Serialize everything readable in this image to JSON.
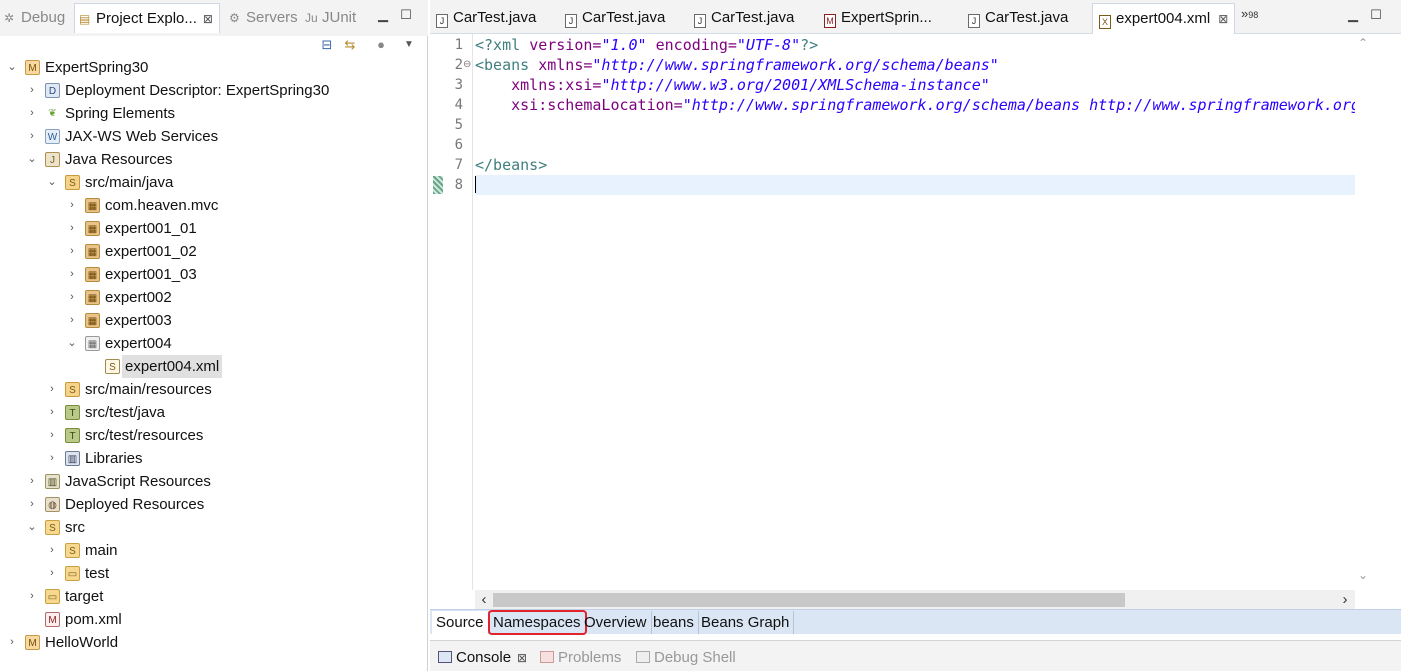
{
  "left_view": {
    "tabs": [
      {
        "label": "Debug"
      },
      {
        "label": "Project Explo..."
      },
      {
        "label": "Servers"
      },
      {
        "label": "JUnit"
      }
    ],
    "close_glyph": "⊠"
  },
  "tree": {
    "items": [
      {
        "label": "ExpertSpring30",
        "icon": "project-icon"
      },
      {
        "label": "Deployment Descriptor: ExpertSpring30",
        "icon": "deployment-descriptor-icon"
      },
      {
        "label": "Spring Elements",
        "icon": "spring-leaf-icon"
      },
      {
        "label": "JAX-WS Web Services",
        "icon": "web-service-icon"
      },
      {
        "label": "Java Resources",
        "icon": "java-resources-icon"
      },
      {
        "label": "src/main/java",
        "icon": "source-folder-icon"
      },
      {
        "label": "com.heaven.mvc",
        "icon": "package-icon"
      },
      {
        "label": "expert001_01",
        "icon": "package-icon"
      },
      {
        "label": "expert001_02",
        "icon": "package-icon"
      },
      {
        "label": "expert001_03",
        "icon": "package-icon"
      },
      {
        "label": "expert002",
        "icon": "package-icon"
      },
      {
        "label": "expert003",
        "icon": "package-icon"
      },
      {
        "label": "expert004",
        "icon": "empty-package-icon"
      },
      {
        "label": "expert004.xml",
        "icon": "spring-xml-file-icon"
      },
      {
        "label": "src/main/resources",
        "icon": "source-folder-icon"
      },
      {
        "label": "src/test/java",
        "icon": "test-source-folder-icon"
      },
      {
        "label": "src/test/resources",
        "icon": "test-source-folder-icon"
      },
      {
        "label": "Libraries",
        "icon": "libraries-icon"
      },
      {
        "label": "JavaScript Resources",
        "icon": "javascript-resources-icon"
      },
      {
        "label": "Deployed Resources",
        "icon": "deployed-resources-icon"
      },
      {
        "label": "src",
        "icon": "folder-icon"
      },
      {
        "label": "main",
        "icon": "folder-icon"
      },
      {
        "label": "test",
        "icon": "folder-icon"
      },
      {
        "label": "target",
        "icon": "folder-icon"
      },
      {
        "label": "pom.xml",
        "icon": "maven-pom-icon"
      },
      {
        "label": "HelloWorld",
        "icon": "project-icon"
      }
    ]
  },
  "editor": {
    "tabs": [
      {
        "label": "CarTest.java",
        "icon": "java-file-icon"
      },
      {
        "label": "CarTest.java",
        "icon": "java-file-icon"
      },
      {
        "label": "CarTest.java",
        "icon": "java-file-icon"
      },
      {
        "label": "ExpertSprin...",
        "icon": "maven-file-icon"
      },
      {
        "label": "CarTest.java",
        "icon": "java-file-icon"
      },
      {
        "label": "expert004.xml",
        "icon": "xml-file-icon"
      }
    ],
    "overflow_count": "98",
    "line_numbers": [
      "1",
      "2",
      "3",
      "4",
      "5",
      "6",
      "7",
      "8"
    ],
    "lines": {
      "l1": {
        "open": "<?xml ",
        "a1": "version=",
        "v1": "\"1.0\"",
        "a2": " encoding=",
        "v2": "\"UTF-8\"",
        "close": "?>"
      },
      "l2": {
        "open": "<beans ",
        "a1": "xmlns=",
        "v1": "\"http://www.springframework.org/schema/beans\""
      },
      "l3": {
        "indent": "    ",
        "a1": "xmlns:xsi=",
        "v1": "\"http://www.w3.org/2001/XMLSchema-instance\""
      },
      "l4": {
        "indent": "    ",
        "a1": "xsi:schemaLocation=",
        "v1": "\"http://www.springframework.org/schema/beans http://www.springframework.org"
      },
      "l7": {
        "close": "</beans>"
      }
    },
    "page_tabs": [
      {
        "label": "Source"
      },
      {
        "label": "Namespaces"
      },
      {
        "label": "Overview"
      },
      {
        "label": "beans"
      },
      {
        "label": "Beans Graph"
      }
    ]
  },
  "bottom_view": {
    "tabs": [
      {
        "label": "Console"
      },
      {
        "label": "Problems"
      },
      {
        "label": "Debug Shell"
      }
    ]
  },
  "colors": {
    "xml_tag": "#3f7f7f",
    "xml_attribute": "#7f007f",
    "xml_value": "#2a00ff",
    "current_line": "#e8f2fe",
    "highlight_circle": "#e0232c"
  }
}
